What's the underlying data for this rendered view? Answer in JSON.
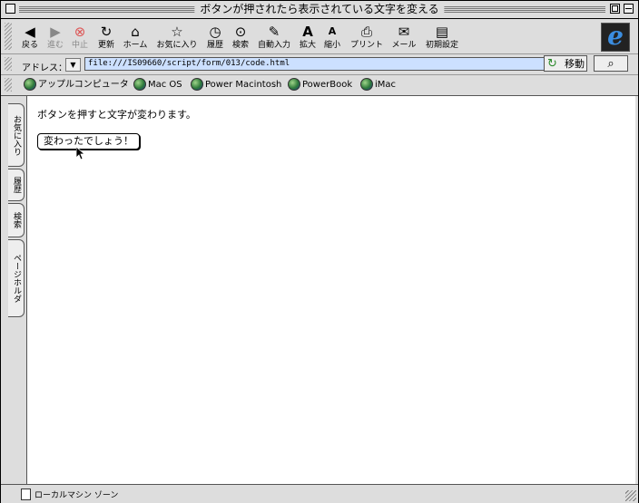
{
  "window": {
    "title": "ボタンが押されたら表示されている文字を変える"
  },
  "toolbar": {
    "buttons": [
      {
        "label": "戻る",
        "icon": "back-arrow-icon",
        "glyph": "◀"
      },
      {
        "label": "進む",
        "icon": "forward-arrow-icon",
        "glyph": "▶"
      },
      {
        "label": "中止",
        "icon": "stop-icon",
        "glyph": "⊗"
      },
      {
        "label": "更新",
        "icon": "refresh-icon",
        "glyph": "↻"
      },
      {
        "label": "ホーム",
        "icon": "home-icon",
        "glyph": "⌂"
      },
      {
        "label": "お気に入り",
        "icon": "favorites-icon",
        "glyph": "☆"
      },
      {
        "label": "履歴",
        "icon": "history-icon",
        "glyph": "◷"
      },
      {
        "label": "検索",
        "icon": "search-icon",
        "glyph": "⊙"
      },
      {
        "label": "自動入力",
        "icon": "autofill-icon",
        "glyph": "✎"
      },
      {
        "label": "拡大",
        "icon": "enlarge-text-icon",
        "glyph": "A"
      },
      {
        "label": "縮小",
        "icon": "shrink-text-icon",
        "glyph": "A"
      },
      {
        "label": "プリント",
        "icon": "print-icon",
        "glyph": "⎙"
      },
      {
        "label": "メール",
        "icon": "mail-icon",
        "glyph": "✉"
      },
      {
        "label": "初期設定",
        "icon": "preferences-icon",
        "glyph": "▤"
      }
    ]
  },
  "address": {
    "label": "アドレス：",
    "url": "file:///IS09660/script/form/013/code.html",
    "go_label": "移動"
  },
  "favorites": {
    "items": [
      {
        "label": "アップルコンピュータ"
      },
      {
        "label": "Mac OS"
      },
      {
        "label": "Power Macintosh"
      },
      {
        "label": "PowerBook"
      },
      {
        "label": "iMac"
      }
    ]
  },
  "sidetabs": {
    "items": [
      {
        "label": "お気に入り"
      },
      {
        "label": "履歴"
      },
      {
        "label": "検索"
      },
      {
        "label": "ページホルダ"
      }
    ]
  },
  "content": {
    "text": "ボタンを押すと文字が変わります。",
    "button_label": "変わったでしょう！"
  },
  "status": {
    "text": "ローカルマシン ゾーン"
  }
}
